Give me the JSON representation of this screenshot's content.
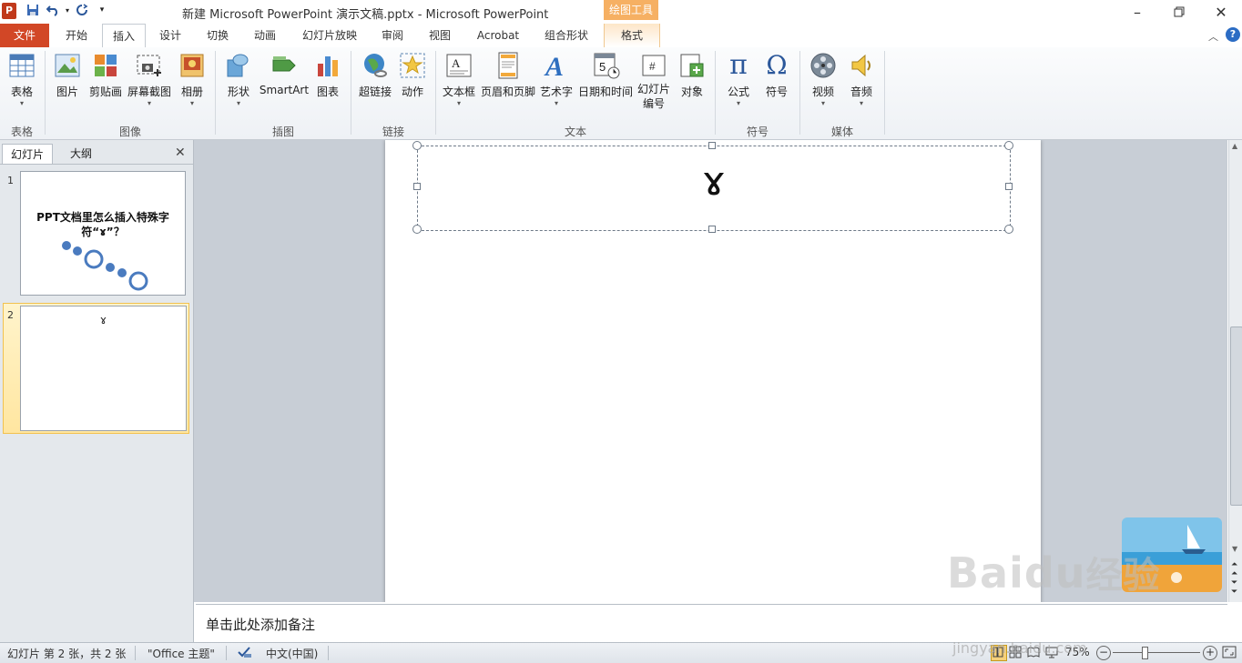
{
  "window": {
    "title": "新建 Microsoft PowerPoint 演示文稿.pptx - Microsoft PowerPoint",
    "context_header": "绘图工具"
  },
  "tabs": {
    "file": "文件",
    "items": [
      "开始",
      "插入",
      "设计",
      "切换",
      "动画",
      "幻灯片放映",
      "审阅",
      "视图",
      "Acrobat",
      "组合形状",
      "格式"
    ],
    "active": "插入"
  },
  "ribbon": {
    "groups": [
      {
        "label": "表格",
        "buttons": [
          "表格"
        ]
      },
      {
        "label": "图像",
        "buttons": [
          "图片",
          "剪贴画",
          "屏幕截图",
          "相册"
        ]
      },
      {
        "label": "插图",
        "buttons": [
          "形状",
          "SmartArt",
          "图表"
        ]
      },
      {
        "label": "链接",
        "buttons": [
          "超链接",
          "动作"
        ]
      },
      {
        "label": "文本",
        "buttons": [
          "文本框",
          "页眉和页脚",
          "艺术字",
          "日期和时间",
          "幻灯片",
          "编号",
          "对象"
        ]
      },
      {
        "label": "符号",
        "buttons": [
          "公式",
          "符号"
        ]
      },
      {
        "label": "媒体",
        "buttons": [
          "视频",
          "音频"
        ]
      }
    ],
    "symbols": {
      "pi": "π",
      "omega": "Ω",
      "a_letter": "A",
      "date_digit": "5",
      "slide_num": "#"
    }
  },
  "slides_panel": {
    "tab_slides": "幻灯片",
    "tab_outline": "大纲",
    "close": "✕",
    "slide1": {
      "num": "1",
      "title": "PPT文档里怎么插入特殊字符“ɤ”？"
    },
    "slide2": {
      "num": "2",
      "symbol": "ɤ"
    }
  },
  "slide": {
    "symbol": "ɤ"
  },
  "notes": {
    "placeholder": "单击此处添加备注"
  },
  "status": {
    "slide_info": "幻灯片 第 2 张，共 2 张",
    "theme": "\"Office 主题\"",
    "language": "中文(中国)",
    "zoom": "75%"
  },
  "watermark": {
    "brand": "Baidu",
    "brand2": "经验",
    "url": "jingyan.baidu.com"
  },
  "colors": {
    "file_tab": "#d24726",
    "context": "#f6b063",
    "accent": "#2b579a"
  }
}
